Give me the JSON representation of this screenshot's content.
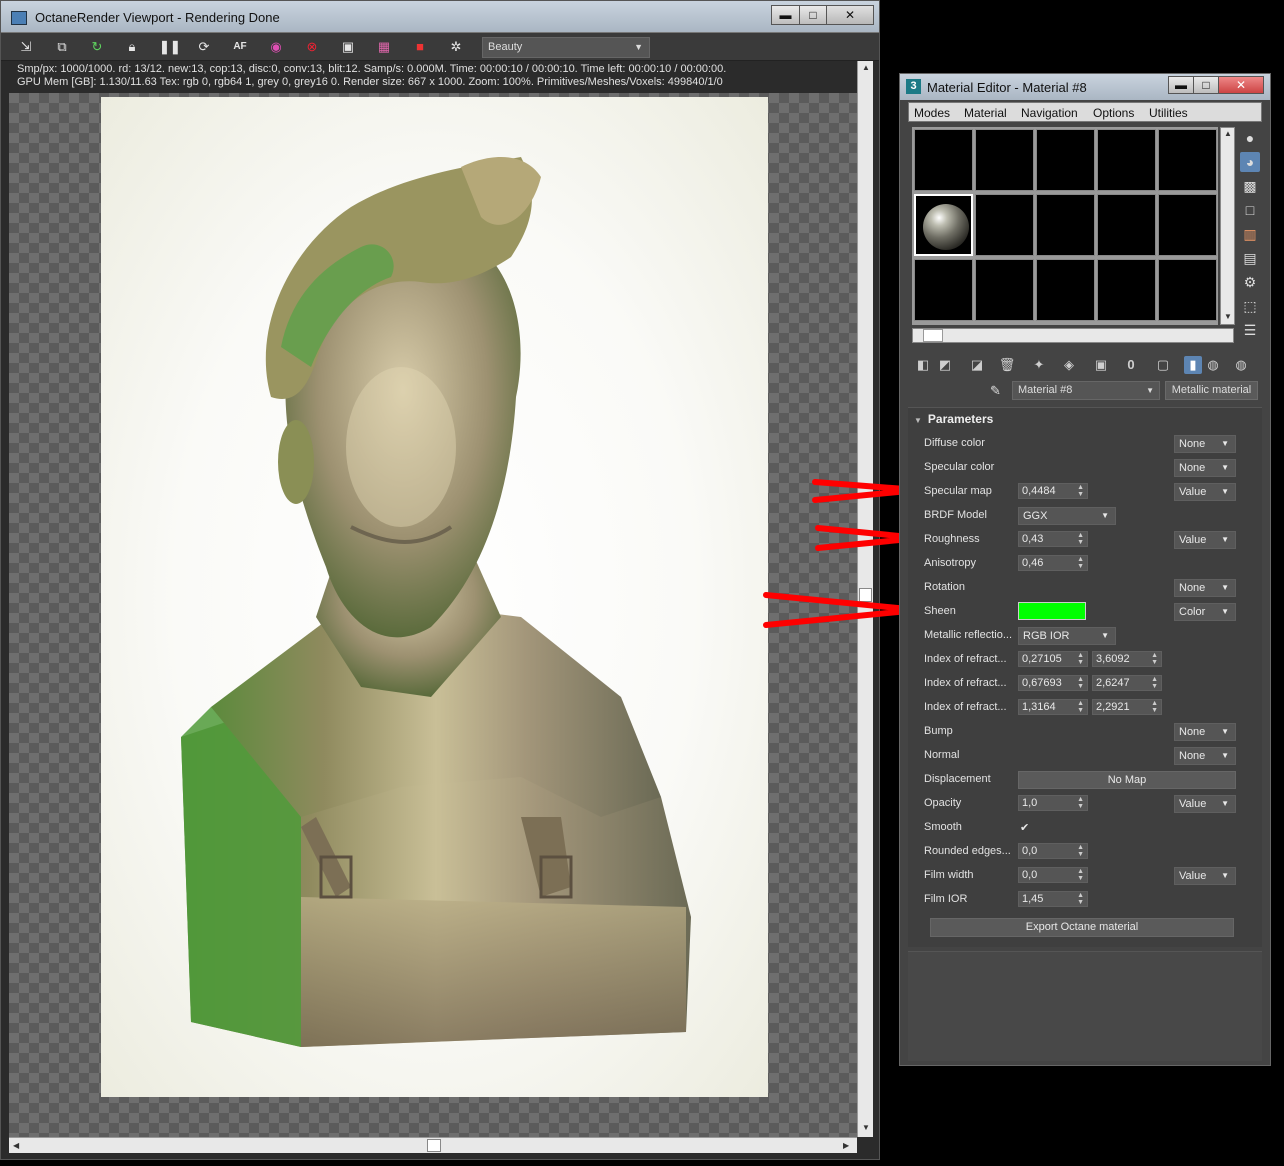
{
  "viewport": {
    "title": "OctaneRender Viewport - Rendering Done",
    "win_min": "▬",
    "win_max": "□",
    "win_close": "✕",
    "pass_select": "Beauty",
    "stats_line1": "Smp/px: 1000/1000.    rd: 13/12.    new:13, cop:13, disc:0, conv:13, blit:12.    Samp/s: 0.000M.    Time: 00:00:10 / 00:00:10.    Time left: 00:00:10 / 00:00:00.",
    "stats_line2": "GPU Mem [GB]: 1.130/11.63    Tex: rgb 0, rgb64 1, grey 0, grey16 0.    Render size: 667 x 1000.    Zoom: 100%.    Primitives/Meshes/Voxels: 499840/1/0",
    "toolbar_icons": [
      "export-icon",
      "copy-icon",
      "restart-icon",
      "lock-icon",
      "pause-icon",
      "refresh-icon",
      "af-icon",
      "color-icon",
      "region-icon",
      "viewport-icon",
      "film-icon",
      "camera-icon",
      "settings-icon"
    ]
  },
  "material_editor": {
    "title": "Material Editor - Material #8",
    "app_badge": "3",
    "menu": [
      "Modes",
      "Material",
      "Navigation",
      "Options",
      "Utilities"
    ],
    "material_name": "Material #8",
    "material_type": "Metallic material",
    "section_title": "Parameters",
    "params": {
      "diffuse_color": {
        "label": "Diffuse color",
        "map": "None"
      },
      "specular_color": {
        "label": "Specular color",
        "map": "None"
      },
      "specular_map": {
        "label": "Specular map",
        "value": "0,4484",
        "map": "Value"
      },
      "brdf_model": {
        "label": "BRDF Model",
        "value": "GGX"
      },
      "roughness": {
        "label": "Roughness",
        "value": "0,43",
        "map": "Value"
      },
      "anisotropy": {
        "label": "Anisotropy",
        "value": "0,46"
      },
      "rotation": {
        "label": "Rotation",
        "map": "None"
      },
      "sheen": {
        "label": "Sheen",
        "color": "#00ff00",
        "map": "Color"
      },
      "metallic_reflection": {
        "label": "Metallic reflectio...",
        "value": "RGB IOR"
      },
      "ior1": {
        "label": "Index of refract...",
        "a": "0,27105",
        "b": "3,6092"
      },
      "ior2": {
        "label": "Index of refract...",
        "a": "0,67693",
        "b": "2,6247"
      },
      "ior3": {
        "label": "Index of refract...",
        "a": "1,3164",
        "b": "2,2921"
      },
      "bump": {
        "label": "Bump",
        "map": "None"
      },
      "normal": {
        "label": "Normal",
        "map": "None"
      },
      "displacement": {
        "label": "Displacement",
        "value": "No Map"
      },
      "opacity": {
        "label": "Opacity",
        "value": "1,0",
        "map": "Value"
      },
      "smooth": {
        "label": "Smooth",
        "value": "✔"
      },
      "rounded_edges": {
        "label": "Rounded edges...",
        "value": "0,0"
      },
      "film_width": {
        "label": "Film width",
        "value": "0,0",
        "map": "Value"
      },
      "film_ior": {
        "label": "Film IOR",
        "value": "1,45"
      }
    },
    "export_button": "Export Octane material"
  },
  "colors": {
    "annotation_arrow": "#ff0000",
    "sheen": "#00ff00",
    "highlight": "#5d85b3"
  }
}
